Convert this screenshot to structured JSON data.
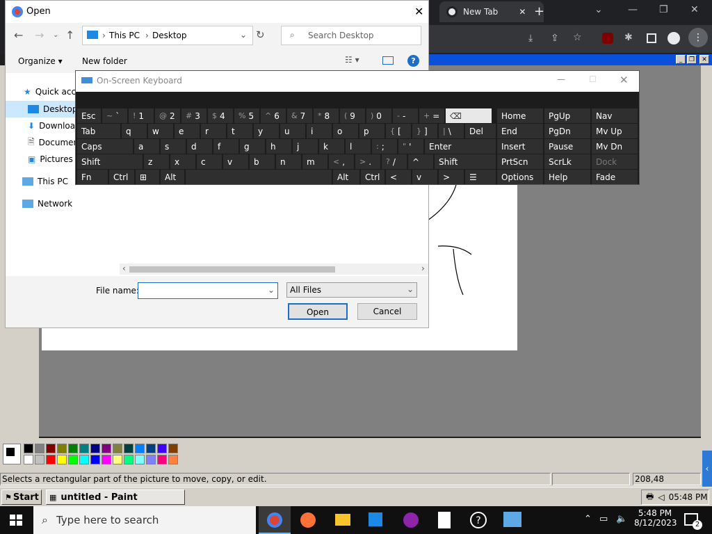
{
  "chrome": {
    "tab_title": "New Tab",
    "tab_close": "✕",
    "new_tab": "+"
  },
  "open_dialog": {
    "title": "Open",
    "breadcrumb": [
      "This PC",
      "Desktop"
    ],
    "search_placeholder": "Search Desktop",
    "organize": "Organize",
    "new_folder": "New folder",
    "tree": [
      "Quick access",
      "Desktop",
      "Downloads",
      "Documents",
      "Pictures",
      "This PC",
      "Network"
    ],
    "file_name_label": "File name:",
    "file_name_value": "",
    "file_type": "All Files",
    "open_button": "Open",
    "cancel_button": "Cancel"
  },
  "osk": {
    "title": "On-Screen Keyboard",
    "rows": [
      [
        {
          "k": "Esc"
        },
        {
          "s": "~",
          "k": "`"
        },
        {
          "s": "!",
          "k": "1"
        },
        {
          "s": "@",
          "k": "2"
        },
        {
          "s": "#",
          "k": "3"
        },
        {
          "s": "$",
          "k": "4"
        },
        {
          "s": "%",
          "k": "5"
        },
        {
          "s": "^",
          "k": "6"
        },
        {
          "s": "&",
          "k": "7"
        },
        {
          "s": "*",
          "k": "8"
        },
        {
          "s": "(",
          "k": "9"
        },
        {
          "s": ")",
          "k": "0"
        },
        {
          "s": "-",
          "k": "-"
        },
        {
          "s": "+",
          "k": "="
        },
        {
          "k": "⌫"
        }
      ],
      [
        {
          "k": "Tab"
        },
        {
          "k": "q"
        },
        {
          "k": "w"
        },
        {
          "k": "e"
        },
        {
          "k": "r"
        },
        {
          "k": "t"
        },
        {
          "k": "y"
        },
        {
          "k": "u"
        },
        {
          "k": "i"
        },
        {
          "k": "o"
        },
        {
          "k": "p"
        },
        {
          "s": "{",
          "k": "["
        },
        {
          "s": "}",
          "k": "]"
        },
        {
          "s": "|",
          "k": "\\"
        },
        {
          "k": "Del"
        }
      ],
      [
        {
          "k": "Caps"
        },
        {
          "k": "a"
        },
        {
          "k": "s"
        },
        {
          "k": "d"
        },
        {
          "k": "f"
        },
        {
          "k": "g"
        },
        {
          "k": "h"
        },
        {
          "k": "j"
        },
        {
          "k": "k"
        },
        {
          "k": "l"
        },
        {
          "s": ":",
          "k": ";"
        },
        {
          "s": "\"",
          "k": "'"
        },
        {
          "k": "Enter"
        }
      ],
      [
        {
          "k": "Shift"
        },
        {
          "k": "z"
        },
        {
          "k": "x"
        },
        {
          "k": "c"
        },
        {
          "k": "v"
        },
        {
          "k": "b"
        },
        {
          "k": "n"
        },
        {
          "k": "m"
        },
        {
          "s": "<",
          "k": ","
        },
        {
          "s": ">",
          "k": "."
        },
        {
          "s": "?",
          "k": "/"
        },
        {
          "k": "^"
        },
        {
          "k": "Shift"
        }
      ],
      [
        {
          "k": "Fn"
        },
        {
          "k": "Ctrl"
        },
        {
          "k": "⊞"
        },
        {
          "k": "Alt"
        },
        {
          "k": ""
        },
        {
          "k": "Alt"
        },
        {
          "k": "Ctrl"
        },
        {
          "k": "<"
        },
        {
          "k": "v"
        },
        {
          "k": ">"
        },
        {
          "k": "☰"
        }
      ]
    ],
    "nav_rows": [
      [
        "Home",
        "PgUp",
        "Nav"
      ],
      [
        "End",
        "PgDn",
        "Mv Up"
      ],
      [
        "Insert",
        "Pause",
        "Mv Dn"
      ],
      [
        "PrtScn",
        "ScrLk",
        "Dock"
      ],
      [
        "Options",
        "Help",
        "Fade"
      ]
    ]
  },
  "paint": {
    "status_text": "Selects a rectangular part of the picture to move, copy, or edit.",
    "coords": "208,48",
    "palette": [
      "#000000",
      "#808080",
      "#800000",
      "#808000",
      "#008000",
      "#008080",
      "#000080",
      "#800080",
      "#808040",
      "#004040",
      "#0080ff",
      "#004080",
      "#4000ff",
      "#804000",
      "#ffffff",
      "#c0c0c0",
      "#ff0000",
      "#ffff00",
      "#00ff00",
      "#00ffff",
      "#0000ff",
      "#ff00ff",
      "#ffff80",
      "#00ff80",
      "#80ffff",
      "#8080ff",
      "#ff0080",
      "#ff8040"
    ]
  },
  "xp_taskbar": {
    "start": "Start",
    "task": "untitled - Paint",
    "clock": "05:48 PM"
  },
  "win_taskbar": {
    "search_placeholder": "Type here to search",
    "time": "5:48 PM",
    "date": "8/12/2023",
    "notif_count": "2"
  }
}
